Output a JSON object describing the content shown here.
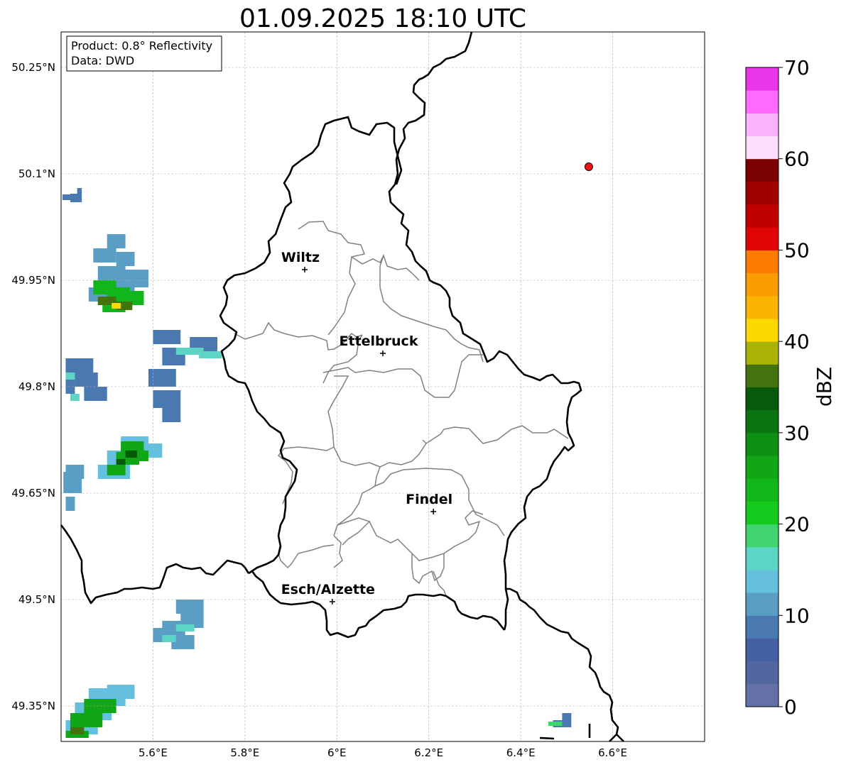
{
  "title": "01.09.2025 18:10 UTC",
  "info_box": {
    "product": "Product: 0.8° Reflectivity",
    "data_source": "Data: DWD"
  },
  "map": {
    "lon_range": [
      5.4,
      6.8
    ],
    "lat_range": [
      49.3,
      50.3
    ],
    "gridlines": true,
    "lon_ticks": [
      {
        "value": 5.6,
        "label": "5.6°E"
      },
      {
        "value": 5.8,
        "label": "5.8°E"
      },
      {
        "value": 6.0,
        "label": "6°E"
      },
      {
        "value": 6.2,
        "label": "6.2°E"
      },
      {
        "value": 6.4,
        "label": "6.4°E"
      },
      {
        "value": 6.6,
        "label": "6.6°E"
      }
    ],
    "lat_ticks": [
      {
        "value": 50.25,
        "label": "50.25°N"
      },
      {
        "value": 50.1,
        "label": "50.1°N"
      },
      {
        "value": 49.95,
        "label": "49.95°N"
      },
      {
        "value": 49.8,
        "label": "49.8°N"
      },
      {
        "value": 49.65,
        "label": "49.65°N"
      },
      {
        "value": 49.5,
        "label": "49.5°N"
      },
      {
        "value": 49.35,
        "label": "49.35°N"
      }
    ],
    "cities": [
      {
        "name": "Wiltz",
        "lon": 5.93,
        "lat": 49.965
      },
      {
        "name": "Ettelbruck",
        "lon": 6.1,
        "lat": 49.847
      },
      {
        "name": "Findel",
        "lon": 6.21,
        "lat": 49.624
      },
      {
        "name": "Esch/Alzette",
        "lon": 5.99,
        "lat": 49.497
      }
    ],
    "radar_site": {
      "lon": 6.548,
      "lat": 50.11,
      "color": "#ee1111"
    },
    "country_border_color": "#000000",
    "canton_border_color": "#808080"
  },
  "colorbar": {
    "label": "dBZ",
    "min": 0,
    "max": 70,
    "step": 2.5,
    "ticks": [
      "0",
      "10",
      "20",
      "30",
      "40",
      "50",
      "60",
      "70"
    ],
    "colors": [
      "#6371a8",
      "#53669f",
      "#4560a2",
      "#4a78b1",
      "#5a9ec5",
      "#64c0dc",
      "#5dd5c4",
      "#3fd46e",
      "#14ca1c",
      "#12b61a",
      "#11a616",
      "#0f8e14",
      "#0a7510",
      "#075a0b",
      "#44720d",
      "#a9b306",
      "#fdd700",
      "#fbb400",
      "#fb9c00",
      "#ff7b00",
      "#e00404",
      "#c00000",
      "#a00000",
      "#7b0000",
      "#fddffd",
      "#fcb1fc",
      "#fe6bfe",
      "#ea35ea"
    ]
  },
  "radar_echoes": [
    {
      "name": "echo-cluster-nw-small",
      "dbz": 8,
      "cells": [
        [
          5.403,
          50.063,
          0.018,
          0.008
        ],
        [
          5.42,
          50.06,
          0.02,
          0.012
        ],
        [
          5.435,
          50.06,
          0.01,
          0.02
        ]
      ]
    },
    {
      "name": "echo-cluster-west-north",
      "dbz": 10,
      "cells": [
        [
          5.5,
          49.995,
          0.04,
          0.02
        ],
        [
          5.47,
          49.975,
          0.05,
          0.02
        ],
        [
          5.52,
          49.97,
          0.04,
          0.02
        ],
        [
          5.48,
          49.945,
          0.06,
          0.025
        ],
        [
          5.53,
          49.94,
          0.06,
          0.025
        ],
        [
          5.5,
          49.92,
          0.06,
          0.025
        ],
        [
          5.46,
          49.92,
          0.05,
          0.02
        ]
      ]
    },
    {
      "name": "echo-core-west-north",
      "dbz": 23,
      "cells": [
        [
          5.47,
          49.93,
          0.05,
          0.02
        ],
        [
          5.5,
          49.92,
          0.05,
          0.02
        ],
        [
          5.53,
          49.915,
          0.05,
          0.02
        ],
        [
          5.49,
          49.905,
          0.05,
          0.015
        ]
      ]
    },
    {
      "name": "echo-peak-west-north",
      "dbz": 37,
      "cells": [
        [
          5.48,
          49.915,
          0.04,
          0.012
        ],
        [
          5.52,
          49.908,
          0.035,
          0.012
        ]
      ]
    },
    {
      "name": "echo-peak-west-north-yellow",
      "dbz": 41,
      "cells": [
        [
          5.51,
          49.91,
          0.02,
          0.008
        ]
      ]
    },
    {
      "name": "echo-cluster-west-middle",
      "dbz": 9,
      "cells": [
        [
          5.6,
          49.86,
          0.06,
          0.02
        ],
        [
          5.68,
          49.85,
          0.06,
          0.02
        ],
        [
          5.62,
          49.83,
          0.05,
          0.025
        ],
        [
          5.59,
          49.8,
          0.06,
          0.025
        ],
        [
          5.6,
          49.77,
          0.06,
          0.025
        ],
        [
          5.62,
          49.75,
          0.04,
          0.02
        ],
        [
          5.41,
          49.82,
          0.06,
          0.02
        ],
        [
          5.43,
          49.8,
          0.05,
          0.02
        ],
        [
          5.45,
          49.78,
          0.05,
          0.02
        ],
        [
          5.41,
          49.79,
          0.02,
          0.04
        ]
      ]
    },
    {
      "name": "echo-cells-west-middle-cyan",
      "dbz": 16,
      "cells": [
        [
          5.65,
          49.845,
          0.06,
          0.01
        ],
        [
          5.7,
          49.84,
          0.05,
          0.01
        ],
        [
          5.41,
          49.81,
          0.02,
          0.01
        ],
        [
          5.42,
          49.78,
          0.02,
          0.01
        ]
      ]
    },
    {
      "name": "echo-cluster-west-south",
      "dbz": 14,
      "cells": [
        [
          5.53,
          49.71,
          0.06,
          0.02
        ],
        [
          5.5,
          49.69,
          0.07,
          0.02
        ],
        [
          5.48,
          49.67,
          0.07,
          0.02
        ],
        [
          5.56,
          49.7,
          0.06,
          0.02
        ]
      ]
    },
    {
      "name": "echo-core-west-south",
      "dbz": 26,
      "cells": [
        [
          5.53,
          49.705,
          0.05,
          0.018
        ],
        [
          5.52,
          49.69,
          0.05,
          0.018
        ],
        [
          5.5,
          49.675,
          0.04,
          0.015
        ],
        [
          5.55,
          49.695,
          0.04,
          0.015
        ]
      ]
    },
    {
      "name": "echo-peak-west-south",
      "dbz": 34,
      "cells": [
        [
          5.54,
          49.7,
          0.025,
          0.01
        ],
        [
          5.52,
          49.69,
          0.02,
          0.008
        ]
      ]
    },
    {
      "name": "echo-cluster-west-edge",
      "dbz": 12,
      "cells": [
        [
          5.405,
          49.65,
          0.04,
          0.03
        ],
        [
          5.41,
          49.67,
          0.04,
          0.02
        ],
        [
          5.41,
          49.625,
          0.02,
          0.02
        ]
      ]
    },
    {
      "name": "echo-cluster-southwest",
      "dbz": 11,
      "cells": [
        [
          5.65,
          49.48,
          0.06,
          0.02
        ],
        [
          5.66,
          49.46,
          0.05,
          0.02
        ],
        [
          5.62,
          49.45,
          0.05,
          0.02
        ],
        [
          5.64,
          49.43,
          0.05,
          0.02
        ],
        [
          5.6,
          49.44,
          0.03,
          0.02
        ]
      ]
    },
    {
      "name": "echo-cells-southwest-cyan",
      "dbz": 15,
      "cells": [
        [
          5.65,
          49.455,
          0.04,
          0.01
        ],
        [
          5.62,
          49.44,
          0.03,
          0.01
        ]
      ]
    },
    {
      "name": "echo-cluster-south-corner",
      "dbz": 14,
      "cells": [
        [
          5.46,
          49.35,
          0.08,
          0.025
        ],
        [
          5.43,
          49.33,
          0.08,
          0.025
        ],
        [
          5.41,
          49.31,
          0.07,
          0.02
        ],
        [
          5.5,
          49.36,
          0.06,
          0.02
        ]
      ]
    },
    {
      "name": "echo-core-south-corner",
      "dbz": 26,
      "cells": [
        [
          5.45,
          49.34,
          0.07,
          0.02
        ],
        [
          5.42,
          49.32,
          0.07,
          0.02
        ],
        [
          5.41,
          49.305,
          0.05,
          0.01
        ]
      ]
    },
    {
      "name": "echo-peak-south-corner",
      "dbz": 37,
      "cells": [
        [
          5.42,
          49.31,
          0.03,
          0.01
        ]
      ]
    },
    {
      "name": "echo-small-southeast",
      "dbz": 9,
      "cells": [
        [
          6.47,
          49.32,
          0.04,
          0.01
        ],
        [
          6.49,
          49.33,
          0.02,
          0.01
        ]
      ]
    },
    {
      "name": "echo-small-southeast-cyan",
      "dbz": 18,
      "cells": [
        [
          6.46,
          49.322,
          0.03,
          0.006
        ]
      ]
    }
  ]
}
